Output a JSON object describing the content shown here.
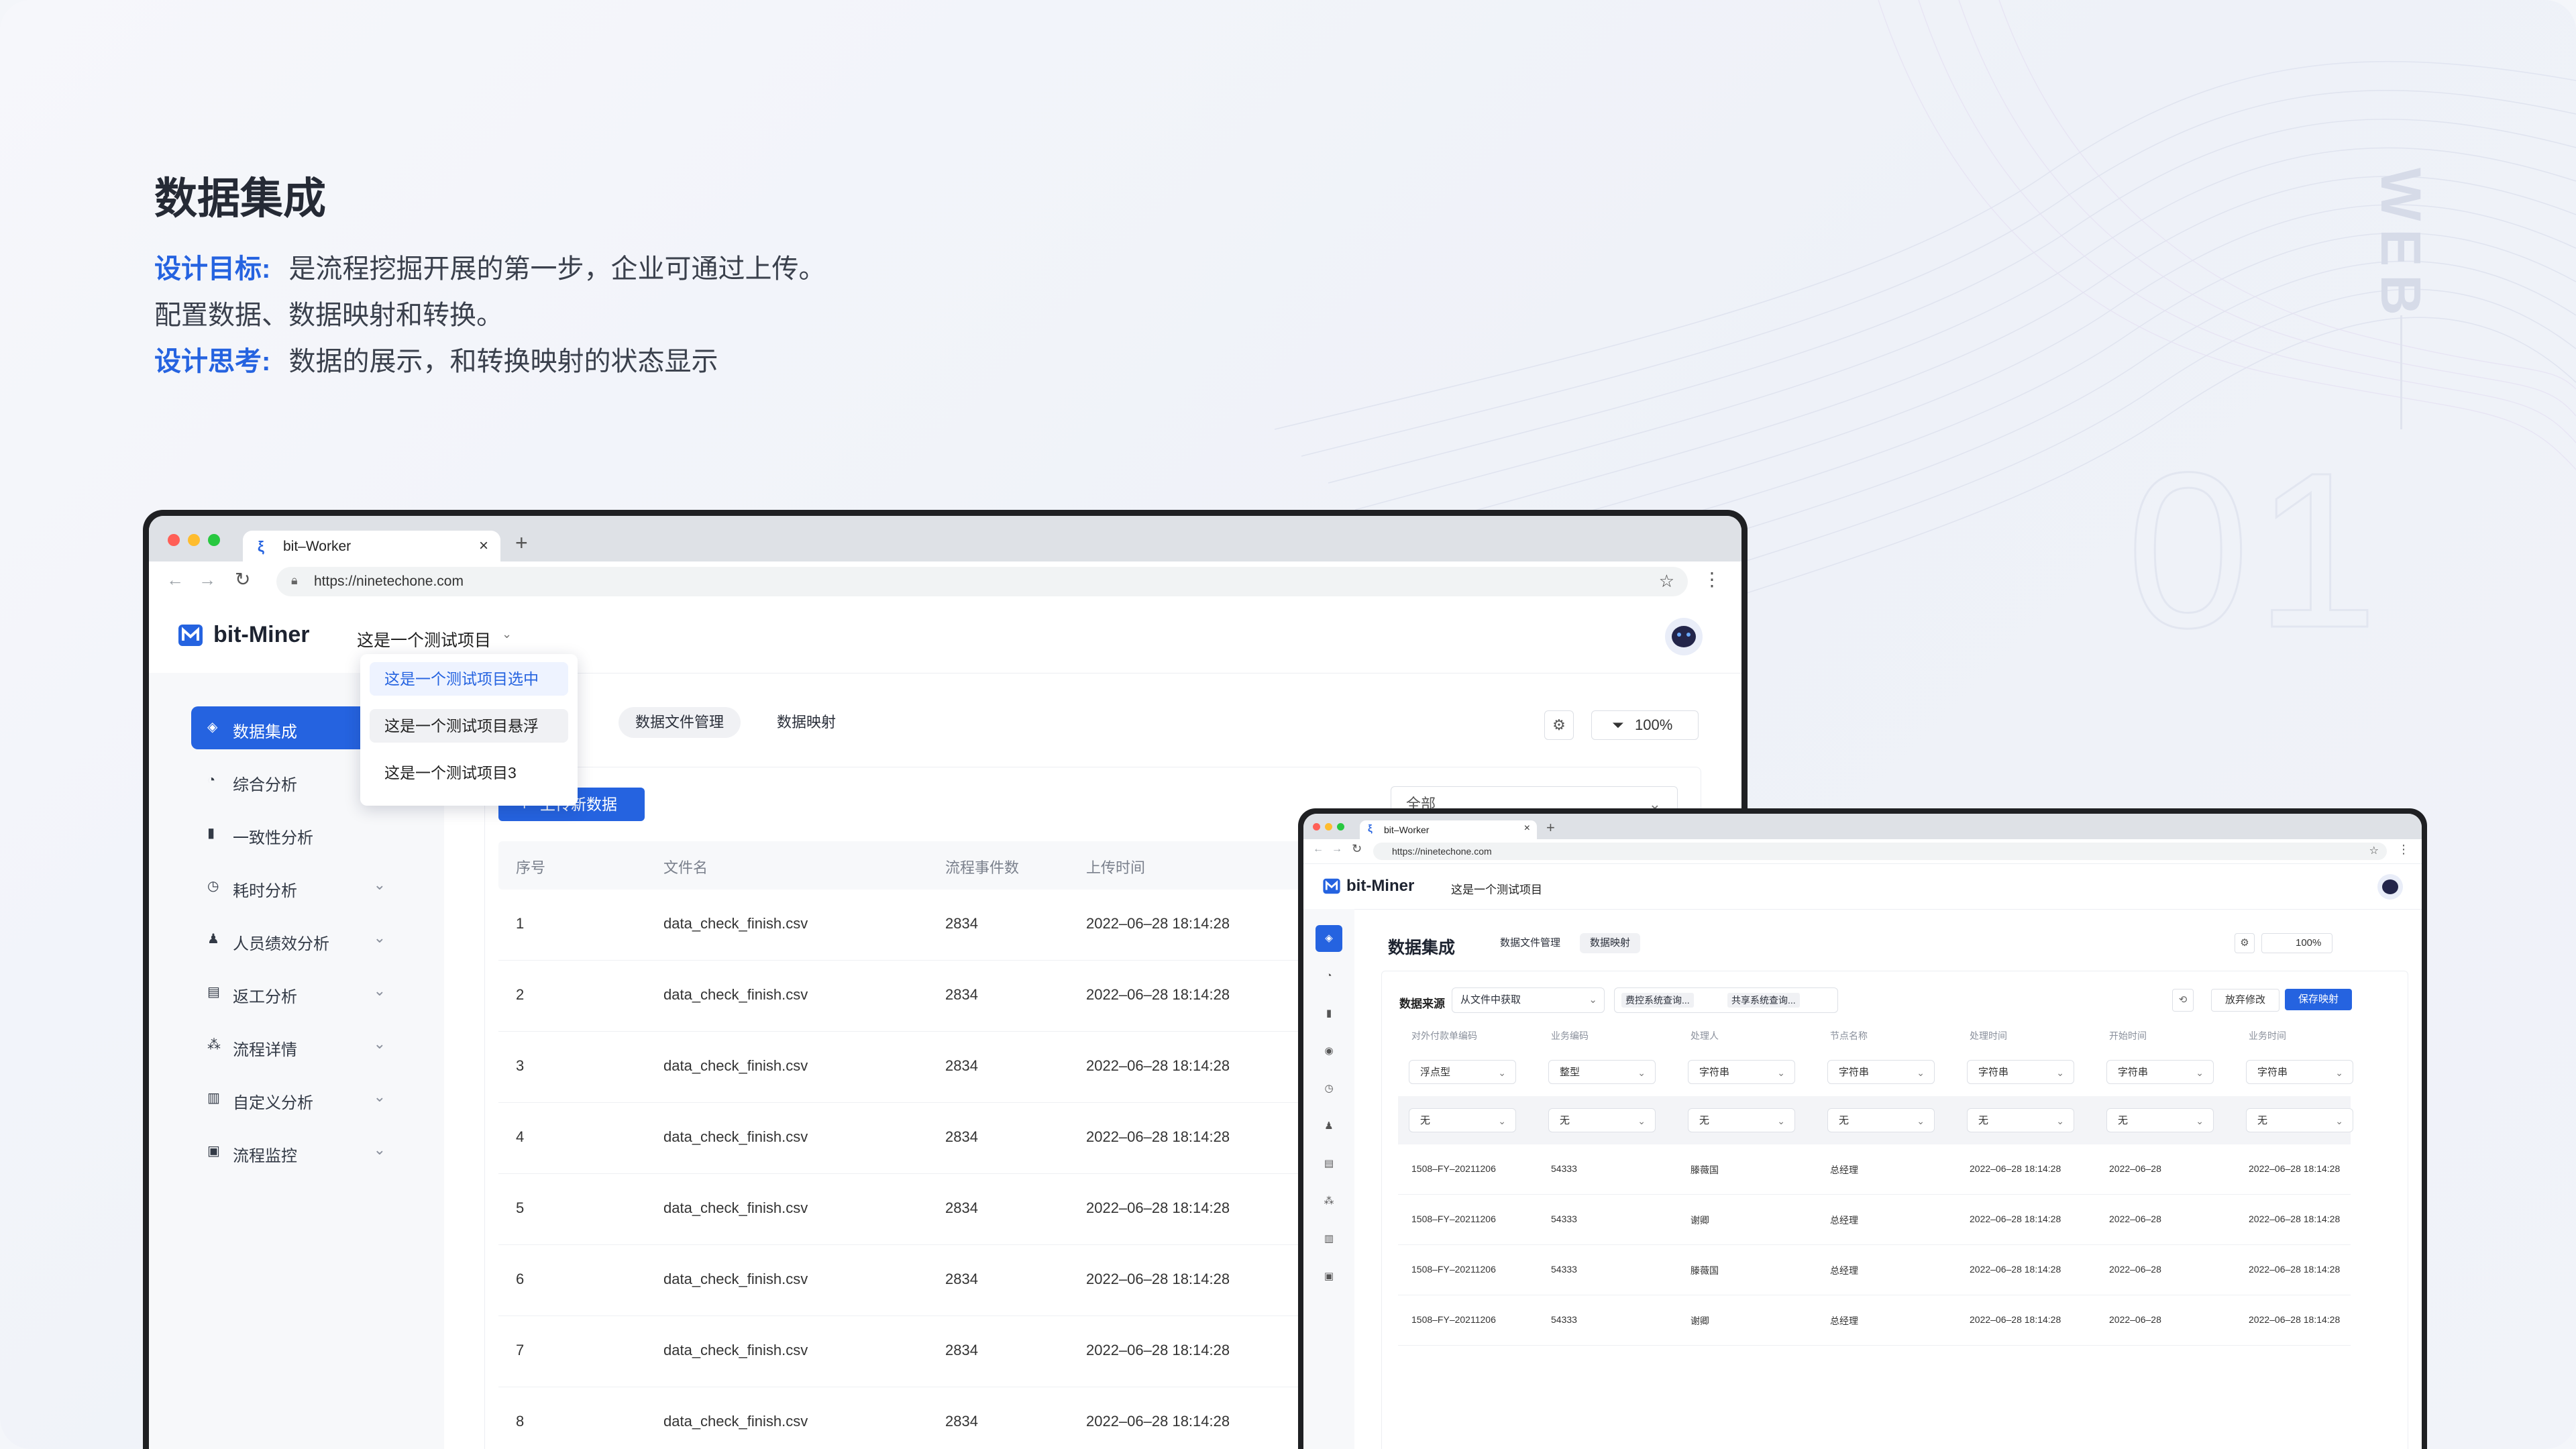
{
  "page": {
    "title": "数据集成",
    "goal_label": "设计目标:",
    "goal_text": "是流程挖掘开展的第一步，企业可通过上传。",
    "goal_text2": "配置数据、数据映射和转换。",
    "think_label": "设计思考:",
    "think_text": "数据的展示，和转换映射的状态显示",
    "web_tag": "WEB",
    "big_number": "01"
  },
  "browser_main": {
    "tab_title": "bit–Worker",
    "url": "https://ninetechone.com",
    "logo_text": "bit-Miner",
    "project_selector": "这是一个测试项目",
    "dropdown": [
      "这是一个测试项目选中",
      "这是一个测试项目悬浮",
      "这是一个测试项目3"
    ],
    "sidebar": [
      {
        "label": "数据集成",
        "icon": "layers-icon",
        "active": true
      },
      {
        "label": "综合分析",
        "icon": "pie-icon"
      },
      {
        "label": "一致性分析",
        "icon": "columns-icon"
      },
      {
        "label": "耗时分析",
        "icon": "clock-icon"
      },
      {
        "label": "人员绩效分析",
        "icon": "user-icon"
      },
      {
        "label": "返工分析",
        "icon": "doc-icon"
      },
      {
        "label": "流程详情",
        "icon": "flow-icon"
      },
      {
        "label": "自定义分析",
        "icon": "bar-chart-icon"
      },
      {
        "label": "流程监控",
        "icon": "monitor-icon"
      }
    ],
    "tabs": [
      "数据文件管理",
      "数据映射"
    ],
    "zoom": "100%",
    "upload_button": "上传新数据",
    "filter_value": "全部",
    "table_headers": [
      "序号",
      "文件名",
      "流程事件数",
      "上传时间"
    ],
    "rows": [
      [
        "1",
        "data_check_finish.csv",
        "2834",
        "2022–06–28 18:14:28"
      ],
      [
        "2",
        "data_check_finish.csv",
        "2834",
        "2022–06–28 18:14:28"
      ],
      [
        "3",
        "data_check_finish.csv",
        "2834",
        "2022–06–28 18:14:28"
      ],
      [
        "4",
        "data_check_finish.csv",
        "2834",
        "2022–06–28 18:14:28"
      ],
      [
        "5",
        "data_check_finish.csv",
        "2834",
        "2022–06–28 18:14:28"
      ],
      [
        "6",
        "data_check_finish.csv",
        "2834",
        "2022–06–28 18:14:28"
      ],
      [
        "7",
        "data_check_finish.csv",
        "2834",
        "2022–06–28 18:14:28"
      ],
      [
        "8",
        "data_check_finish.csv",
        "2834",
        "2022–06–28 18:14:28"
      ]
    ]
  },
  "browser_second": {
    "tab_title": "bit–Worker",
    "url": "https://ninetechone.com",
    "logo_text": "bit-Miner",
    "project_selector": "这是一个测试项目",
    "page_title": "数据集成",
    "tabs": [
      "数据文件管理",
      "数据映射"
    ],
    "zoom": "100%",
    "source_label": "数据来源",
    "source_value": "从文件中获取",
    "tags": [
      "费控系统查询...",
      "共享系统查询..."
    ],
    "discard_button": "放弃修改",
    "save_button": "保存映射",
    "columns": [
      "对外付款单编码",
      "业务编码",
      "处理人",
      "节点名称",
      "处理时间",
      "开始时间",
      "业务时间"
    ],
    "type_row": [
      "浮点型",
      "整型",
      "字符串",
      "字符串",
      "字符串",
      "字符串",
      "字符串"
    ],
    "mapping_row": [
      "无",
      "无",
      "无",
      "无",
      "无",
      "无",
      "无"
    ],
    "rows": [
      [
        "1508–FY–20211206",
        "54333",
        "滕薇国",
        "总经理",
        "2022–06–28 18:14:28",
        "2022–06–28",
        "2022–06–28 18:14:28"
      ],
      [
        "1508–FY–20211206",
        "54333",
        "谢卿",
        "总经理",
        "2022–06–28 18:14:28",
        "2022–06–28",
        "2022–06–28 18:14:28"
      ],
      [
        "1508–FY–20211206",
        "54333",
        "滕薇国",
        "总经理",
        "2022–06–28 18:14:28",
        "2022–06–28",
        "2022–06–28 18:14:28"
      ],
      [
        "1508–FY–20211206",
        "54333",
        "谢卿",
        "总经理",
        "2022–06–28 18:14:28",
        "2022–06–28",
        "2022–06–28 18:14:28"
      ]
    ]
  },
  "colors": {
    "accent": "#2563e0",
    "title_blue": "#2563e0",
    "sidebar_bg": "#f7f8fa"
  }
}
